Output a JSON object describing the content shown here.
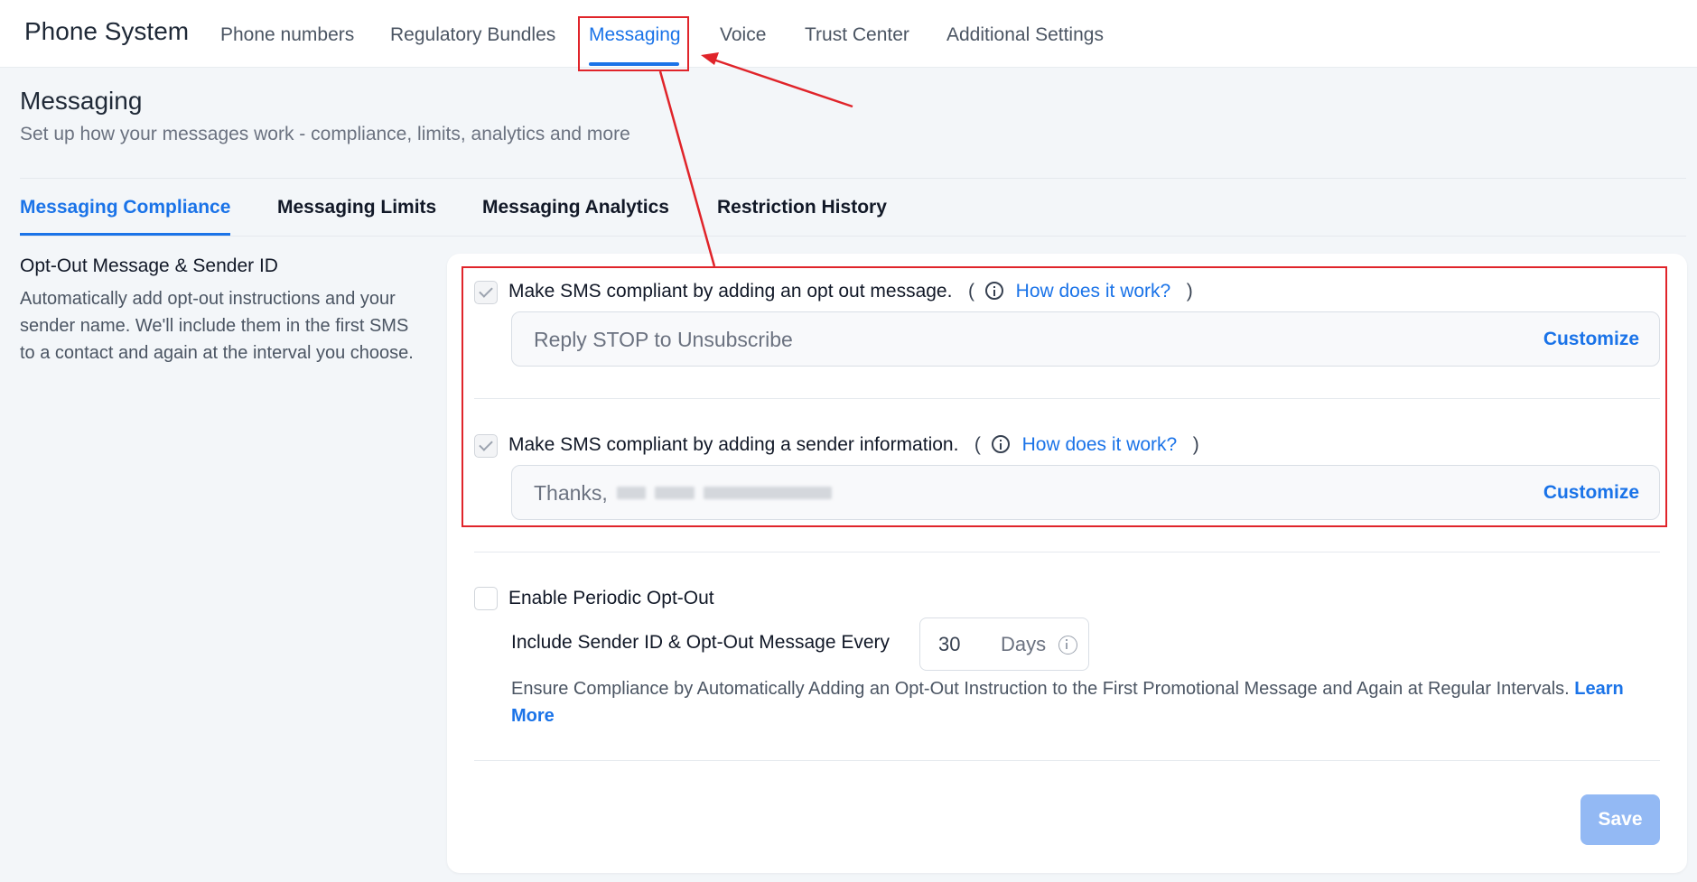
{
  "app": {
    "title": "Phone System"
  },
  "nav": {
    "items": [
      {
        "label": "Phone numbers"
      },
      {
        "label": "Regulatory Bundles"
      },
      {
        "label": "Messaging"
      },
      {
        "label": "Voice"
      },
      {
        "label": "Trust Center"
      },
      {
        "label": "Additional Settings"
      }
    ],
    "active": "Messaging"
  },
  "page": {
    "title": "Messaging",
    "subtitle": "Set up how your messages work - compliance, limits, analytics and more"
  },
  "tabs": [
    {
      "label": "Messaging Compliance"
    },
    {
      "label": "Messaging Limits"
    },
    {
      "label": "Messaging Analytics"
    },
    {
      "label": "Restriction History"
    }
  ],
  "section": {
    "title": "Opt-Out Message & Sender ID",
    "description": "Automatically add opt-out instructions and your sender name. We'll include them in the first SMS to a contact and again at the interval you choose."
  },
  "opt_out": {
    "label": "Make SMS compliant by adding an opt out message.",
    "help_link": "How does it work?",
    "value": "Reply STOP to Unsubscribe",
    "action": "Customize"
  },
  "sender": {
    "label": "Make SMS compliant by adding a sender information.",
    "help_link": "How does it work?",
    "value_prefix": "Thanks,",
    "action": "Customize"
  },
  "periodic": {
    "label": "Enable Periodic Opt-Out",
    "interval_label": "Include Sender ID & Opt-Out Message Every",
    "interval_value": "30",
    "interval_unit": "Days",
    "description": "Ensure Compliance by Automatically Adding an Opt-Out Instruction to the First Promotional Message and Again at Regular Intervals.",
    "learn_more": "Learn More"
  },
  "actions": {
    "save": "Save"
  },
  "colors": {
    "accent": "#1a73e8",
    "annotation": "#e0242a",
    "save_disabled": "#93b9f4"
  }
}
